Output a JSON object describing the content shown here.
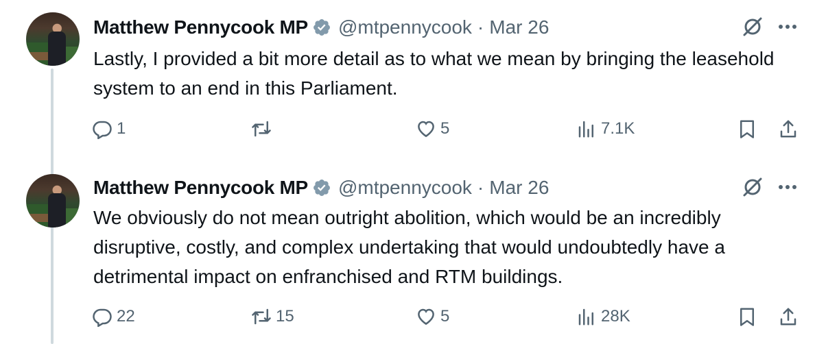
{
  "tweets": [
    {
      "author": "Matthew Pennycook MP",
      "handle": "@mtpennycook",
      "separator": "·",
      "date": "Mar 26",
      "text": "Lastly, I provided a bit more detail as to what we mean by bringing the leasehold system to an end in this Parliament.",
      "replies": "1",
      "retweets": "",
      "likes": "5",
      "views": "7.1K"
    },
    {
      "author": "Matthew Pennycook MP",
      "handle": "@mtpennycook",
      "separator": "·",
      "date": "Mar 26",
      "text": "We obviously do not mean outright abolition, which would be an incredibly disruptive, costly, and complex undertaking that would undoubtedly have a detrimental impact on enfranchised and RTM buildings.",
      "replies": "22",
      "retweets": "15",
      "likes": "5",
      "views": "28K"
    }
  ],
  "colors": {
    "text": "#0f1419",
    "secondary": "#536471",
    "verified_badge": "#829aab",
    "thread_line": "#cfd9de"
  },
  "icons": [
    "verified-badge-icon",
    "grok-icon",
    "more-icon",
    "reply-icon",
    "retweet-icon",
    "like-icon",
    "views-icon",
    "bookmark-icon",
    "share-icon"
  ]
}
